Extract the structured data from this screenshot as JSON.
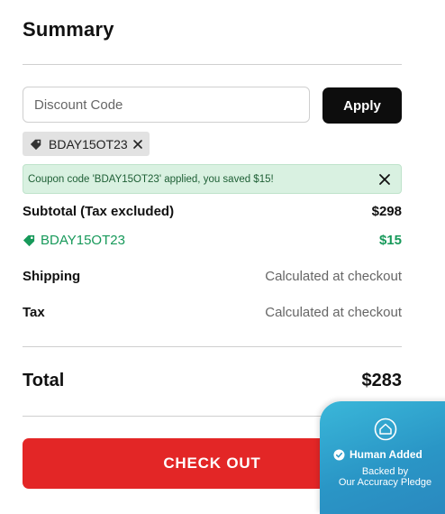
{
  "summary": {
    "title": "Summary"
  },
  "discount": {
    "placeholder": "Discount Code",
    "value": "",
    "apply_label": "Apply"
  },
  "coupon_chip": {
    "code": "BDAY15OT23",
    "icon": "tag-icon",
    "close_icon": "close-icon"
  },
  "success_banner": {
    "message": "Coupon code 'BDAY15OT23' applied, you saved $15!",
    "close_icon": "close-icon",
    "color": "#d9f1e1"
  },
  "lines": {
    "subtotal": {
      "label": "Subtotal (Tax excluded)",
      "value": "$298"
    },
    "discount": {
      "label": "BDAY15OT23",
      "value": "$15",
      "color": "#17995a"
    },
    "shipping": {
      "label": "Shipping",
      "value": "Calculated at checkout"
    },
    "tax": {
      "label": "Tax",
      "value": "Calculated at checkout"
    }
  },
  "total": {
    "label": "Total",
    "value": "$283"
  },
  "checkout": {
    "label": "CHECK OUT",
    "color": "#e32626"
  },
  "pledge_badge": {
    "title": "Human Added",
    "line1": "Backed by",
    "line2": "Our Accuracy Pledge",
    "icon": "shield-check-icon"
  }
}
